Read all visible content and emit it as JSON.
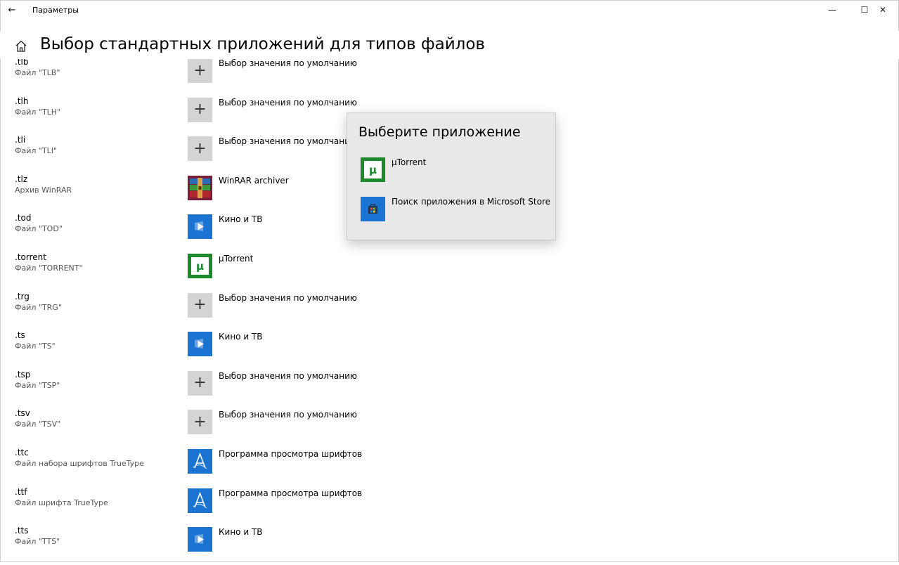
{
  "window": {
    "app_title": "Параметры",
    "back_glyph": "←",
    "minimize_glyph": "—",
    "maximize_glyph": "☐",
    "close_glyph": "✕"
  },
  "page": {
    "title": "Выбор стандартных приложений для типов файлов"
  },
  "rows": [
    {
      "ext": ".tlb",
      "desc": "Файл \"TLB\"",
      "app": "Выбор значения по умолчанию",
      "icon": "plus-icon"
    },
    {
      "ext": ".tlh",
      "desc": "Файл \"TLH\"",
      "app": "Выбор значения по умолчанию",
      "icon": "plus-icon"
    },
    {
      "ext": ".tli",
      "desc": "Файл \"TLI\"",
      "app": "Выбор значения по умолчанию",
      "icon": "plus-icon"
    },
    {
      "ext": ".tlz",
      "desc": "Архив WinRAR",
      "app": "WinRAR archiver",
      "icon": "winrar-icon"
    },
    {
      "ext": ".tod",
      "desc": "Файл \"TOD\"",
      "app": "Кино и ТВ",
      "icon": "movies-tv-icon"
    },
    {
      "ext": ".torrent",
      "desc": "Файл \"TORRENT\"",
      "app": "µTorrent",
      "icon": "utorrent-icon"
    },
    {
      "ext": ".trg",
      "desc": "Файл \"TRG\"",
      "app": "Выбор значения по умолчанию",
      "icon": "plus-icon"
    },
    {
      "ext": ".ts",
      "desc": "Файл \"TS\"",
      "app": "Кино и ТВ",
      "icon": "movies-tv-icon"
    },
    {
      "ext": ".tsp",
      "desc": "Файл \"TSP\"",
      "app": "Выбор значения по умолчанию",
      "icon": "plus-icon"
    },
    {
      "ext": ".tsv",
      "desc": "Файл \"TSV\"",
      "app": "Выбор значения по умолчанию",
      "icon": "plus-icon"
    },
    {
      "ext": ".ttc",
      "desc": "Файл набора шрифтов TrueType",
      "app": "Программа просмотра шрифтов",
      "icon": "font-viewer-icon"
    },
    {
      "ext": ".ttf",
      "desc": "Файл шрифта TrueType",
      "app": "Программа просмотра шрифтов",
      "icon": "font-viewer-icon"
    },
    {
      "ext": ".tts",
      "desc": "Файл \"TTS\"",
      "app": "Кино и ТВ",
      "icon": "movies-tv-icon"
    }
  ],
  "popup": {
    "title": "Выберите приложение",
    "items": [
      {
        "label": "µTorrent",
        "icon": "utorrent-icon"
      },
      {
        "label": "Поиск приложения в Microsoft Store",
        "icon": "store-icon"
      }
    ]
  },
  "colors": {
    "accent": "#1b74d2",
    "utorrent": "#1a8a2c",
    "plus_tile": "#d4d4d4",
    "popup_bg": "#e8e8e8"
  }
}
